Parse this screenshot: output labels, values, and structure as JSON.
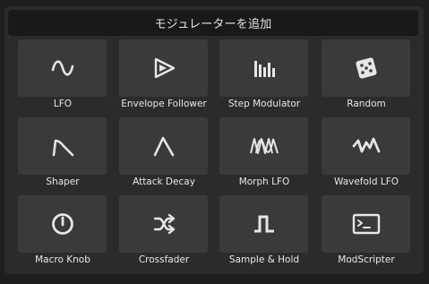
{
  "dialog": {
    "title": "モジュレーターを追加"
  },
  "modulators": [
    {
      "label": "LFO",
      "icon": "sine-wave-icon"
    },
    {
      "label": "Envelope Follower",
      "icon": "envelope-follower-icon"
    },
    {
      "label": "Step Modulator",
      "icon": "step-bars-icon"
    },
    {
      "label": "Random",
      "icon": "dice-icon"
    },
    {
      "label": "Shaper",
      "icon": "shaper-curve-icon"
    },
    {
      "label": "Attack Decay",
      "icon": "attack-decay-icon"
    },
    {
      "label": "Morph LFO",
      "icon": "morph-wave-icon"
    },
    {
      "label": "Wavefold LFO",
      "icon": "wavefold-icon"
    },
    {
      "label": "Macro Knob",
      "icon": "knob-icon"
    },
    {
      "label": "Crossfader",
      "icon": "shuffle-arrows-icon"
    },
    {
      "label": "Sample & Hold",
      "icon": "sample-hold-icon"
    },
    {
      "label": "ModScripter",
      "icon": "terminal-icon"
    }
  ],
  "colors": {
    "background": "#1e1e1e",
    "panel": "#2b2b2b",
    "header": "#191919",
    "tile": "#3a3a3a",
    "icon": "#e6e6e6",
    "text": "#e8e8e8"
  }
}
